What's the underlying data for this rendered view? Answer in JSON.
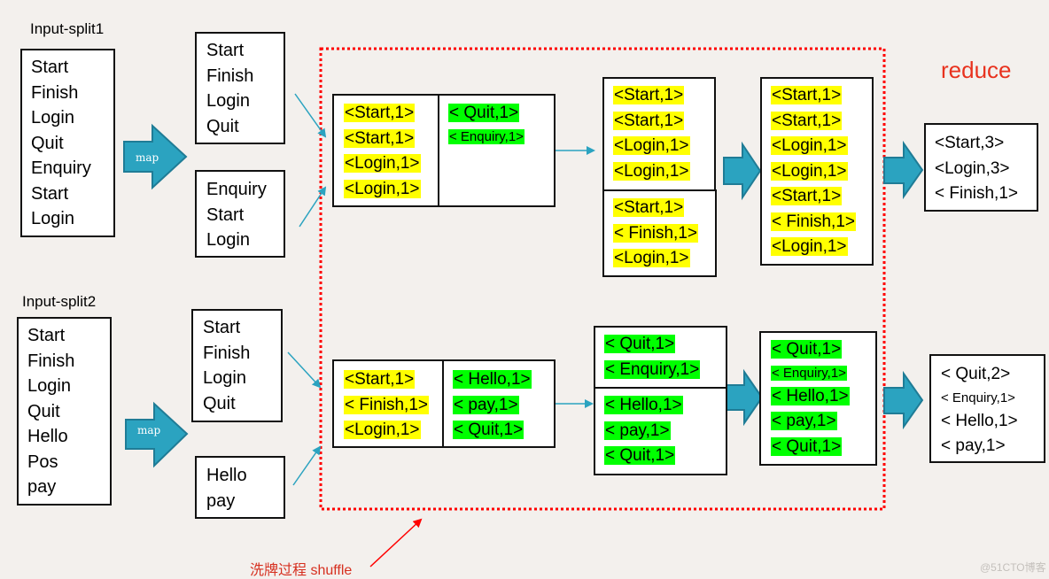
{
  "split1": {
    "title": "Input-split1",
    "items": [
      "Start",
      "Finish",
      "Login",
      "Quit",
      "Enquiry",
      "Start",
      "Login"
    ],
    "map_label": "map",
    "map_out_a": [
      "Start",
      "Finish",
      "Login",
      "Quit"
    ],
    "map_out_b": [
      "Enquiry",
      "Start",
      "Login"
    ]
  },
  "split2": {
    "title": "Input-split2",
    "items": [
      "Start",
      "Finish",
      "Login",
      "Quit",
      "Hello",
      "Pos",
      "pay"
    ],
    "map_label": "map",
    "map_out_a": [
      "Start",
      "Finish",
      "Login",
      "Quit"
    ],
    "map_out_b": [
      "Hello",
      "pay"
    ]
  },
  "shuffle1": {
    "partition_yellow": [
      "<Start,1>",
      "<Start,1>",
      "<Login,1>",
      "<Login,1>"
    ],
    "partition_green": [
      "< Quit,1>",
      "< Enquiry,1>"
    ],
    "merge_top": [
      "<Start,1>",
      "<Start,1>",
      "<Login,1>",
      "<Login,1>"
    ],
    "merge_bottom": [
      "<Start,1>",
      "< Finish,1>",
      "<Login,1>"
    ],
    "sorted": [
      "<Start,1>",
      "<Start,1>",
      "<Login,1>",
      "<Login,1>",
      "<Start,1>",
      "< Finish,1>",
      "<Login,1>"
    ]
  },
  "shuffle2": {
    "partition_yellow": [
      "<Start,1>",
      "< Finish,1>",
      "<Login,1>"
    ],
    "partition_green": [
      "< Hello,1>",
      "< pay,1>",
      "< Quit,1>"
    ],
    "merge_top": [
      "< Quit,1>",
      "< Enquiry,1>"
    ],
    "merge_bottom": [
      "< Hello,1>",
      "< pay,1>",
      "< Quit,1>"
    ],
    "sorted": [
      "< Quit,1>",
      "< Enquiry,1>",
      "< Hello,1>",
      "< pay,1>",
      "< Quit,1>"
    ]
  },
  "reduce": {
    "title": "reduce",
    "output1": [
      "<Start,3>",
      "<Login,3>",
      "< Finish,1>"
    ],
    "output2": [
      "< Quit,2>",
      "< Enquiry,1>",
      "< Hello,1>",
      "< pay,1>"
    ]
  },
  "shuffle_label": "洗牌过程  shuffle",
  "watermark": "@51CTO博客",
  "colors": {
    "arrow": "#2ba3c0",
    "arrow_dark": "#1f7c96",
    "dashed": "#ff0000",
    "yellow": "#ffff00",
    "green": "#00ff00",
    "reduce_title": "#e8321e"
  }
}
